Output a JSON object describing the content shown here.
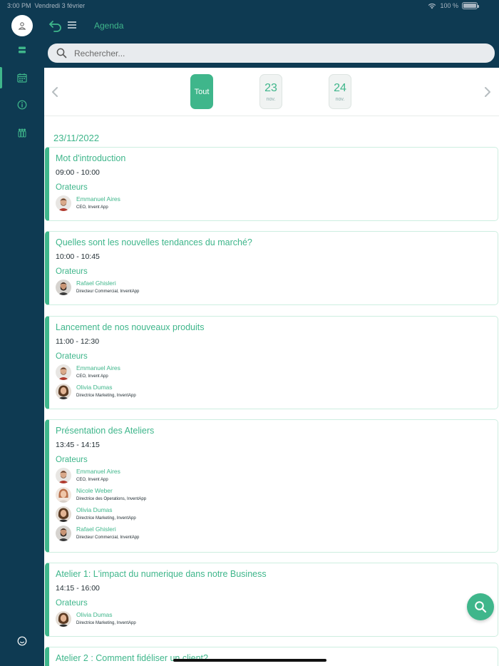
{
  "status": {
    "time": "3:00 PM",
    "date": "Vendredi 3 février",
    "battery": "100 %"
  },
  "header": {
    "title": "Agenda"
  },
  "search": {
    "placeholder": "Rechercher..."
  },
  "dates": {
    "all_label": "Tout",
    "days": [
      {
        "num": "23",
        "month": "nov."
      },
      {
        "num": "24",
        "month": "nov."
      }
    ]
  },
  "agenda": {
    "date_heading": "23/11/2022",
    "speakers_label": "Orateurs",
    "sessions": [
      {
        "title": "Mot d'introduction",
        "time": "09:00 - 10:00",
        "speakers": [
          {
            "name": "Emmanuel Aires",
            "role": "CEO, Invent App"
          }
        ]
      },
      {
        "title": "Quelles sont les nouvelles tendances du marché?",
        "time": "10:00 - 10:45",
        "speakers": [
          {
            "name": "Rafael Ghisleri",
            "role": "Directeur Commercial, InventApp"
          }
        ]
      },
      {
        "title": "Lancement de nos nouveaux produits",
        "time": "11:00 - 12:30",
        "speakers": [
          {
            "name": "Emmanuel Aires",
            "role": "CEO, Invent App"
          },
          {
            "name": "Olivia Dumas",
            "role": "Directrice Marketing, InventApp"
          }
        ]
      },
      {
        "title": "Présentation des Ateliers",
        "time": "13:45 - 14:15",
        "speakers": [
          {
            "name": "Emmanuel Aires",
            "role": "CEO, Invent App"
          },
          {
            "name": "Nicole Weber",
            "role": "Directrice des Operations, InventApp"
          },
          {
            "name": "Olivia Dumas",
            "role": "Directrice Marketing, InventApp"
          },
          {
            "name": "Rafael Ghisleri",
            "role": "Directeur Commercial, InventApp"
          }
        ]
      },
      {
        "title": "Atelier 1: L'impact du numerique dans notre Business",
        "time": "14:15 - 16:00",
        "speakers": [
          {
            "name": "Olivia Dumas",
            "role": "Directrice Marketing, InventApp"
          }
        ]
      },
      {
        "title": "Atelier 2 : Comment fidéliser un client?"
      }
    ]
  },
  "colors": {
    "brand_dark": "#0e3a52",
    "accent": "#3fb68b"
  }
}
